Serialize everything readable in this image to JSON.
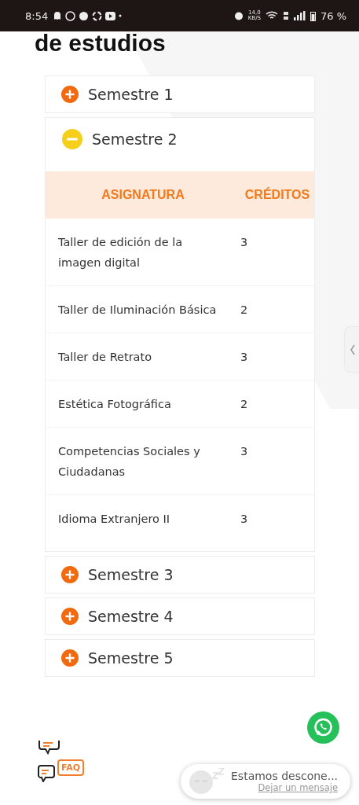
{
  "status_bar": {
    "time": "8:54",
    "net_speed": "14,0",
    "net_unit": "KB/S",
    "battery": "76 %"
  },
  "heading": "de estudios",
  "semesters": [
    {
      "title": "Semestre 1",
      "expanded": false
    },
    {
      "title": "Semestre 2",
      "expanded": true,
      "table": {
        "columns": [
          "ASIGNATURA",
          "CRÉDITOS"
        ],
        "rows": [
          [
            "Taller de edición de la imagen digital",
            "3"
          ],
          [
            "Taller de Iluminación Básica",
            "2"
          ],
          [
            "Taller de Retrato",
            "3"
          ],
          [
            "Estética Fotográfica",
            "2"
          ],
          [
            "Competencias Sociales y Ciudadanas",
            "3"
          ],
          [
            "Idioma Extranjero II",
            "3"
          ]
        ]
      }
    },
    {
      "title": "Semestre 3",
      "expanded": false
    },
    {
      "title": "Semestre 4",
      "expanded": false
    },
    {
      "title": "Semestre 5",
      "expanded": false
    }
  ],
  "faq_label": "FAQ",
  "chat": {
    "status": "Estamos descone...",
    "link": "Dejar un mensaje"
  }
}
